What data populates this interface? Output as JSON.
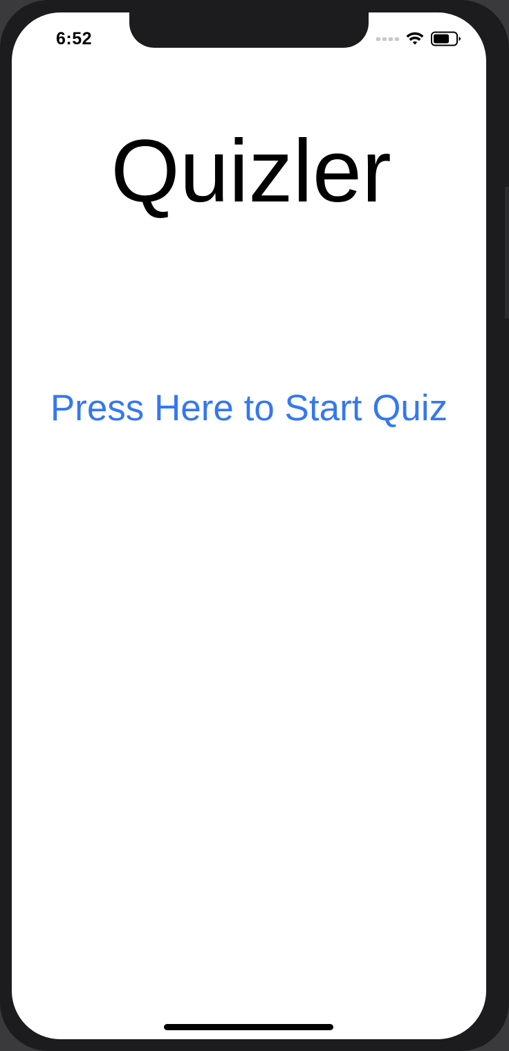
{
  "status_bar": {
    "time": "6:52"
  },
  "main": {
    "title": "Quizler",
    "start_button_label": "Press Here to Start Quiz"
  },
  "colors": {
    "accent": "#3478f0",
    "title": "#000000",
    "screen_background": "#ffffff",
    "device_frame": "#1c1c1e"
  },
  "icons": [
    "cellular-signal-icon",
    "wifi-icon",
    "battery-icon"
  ]
}
